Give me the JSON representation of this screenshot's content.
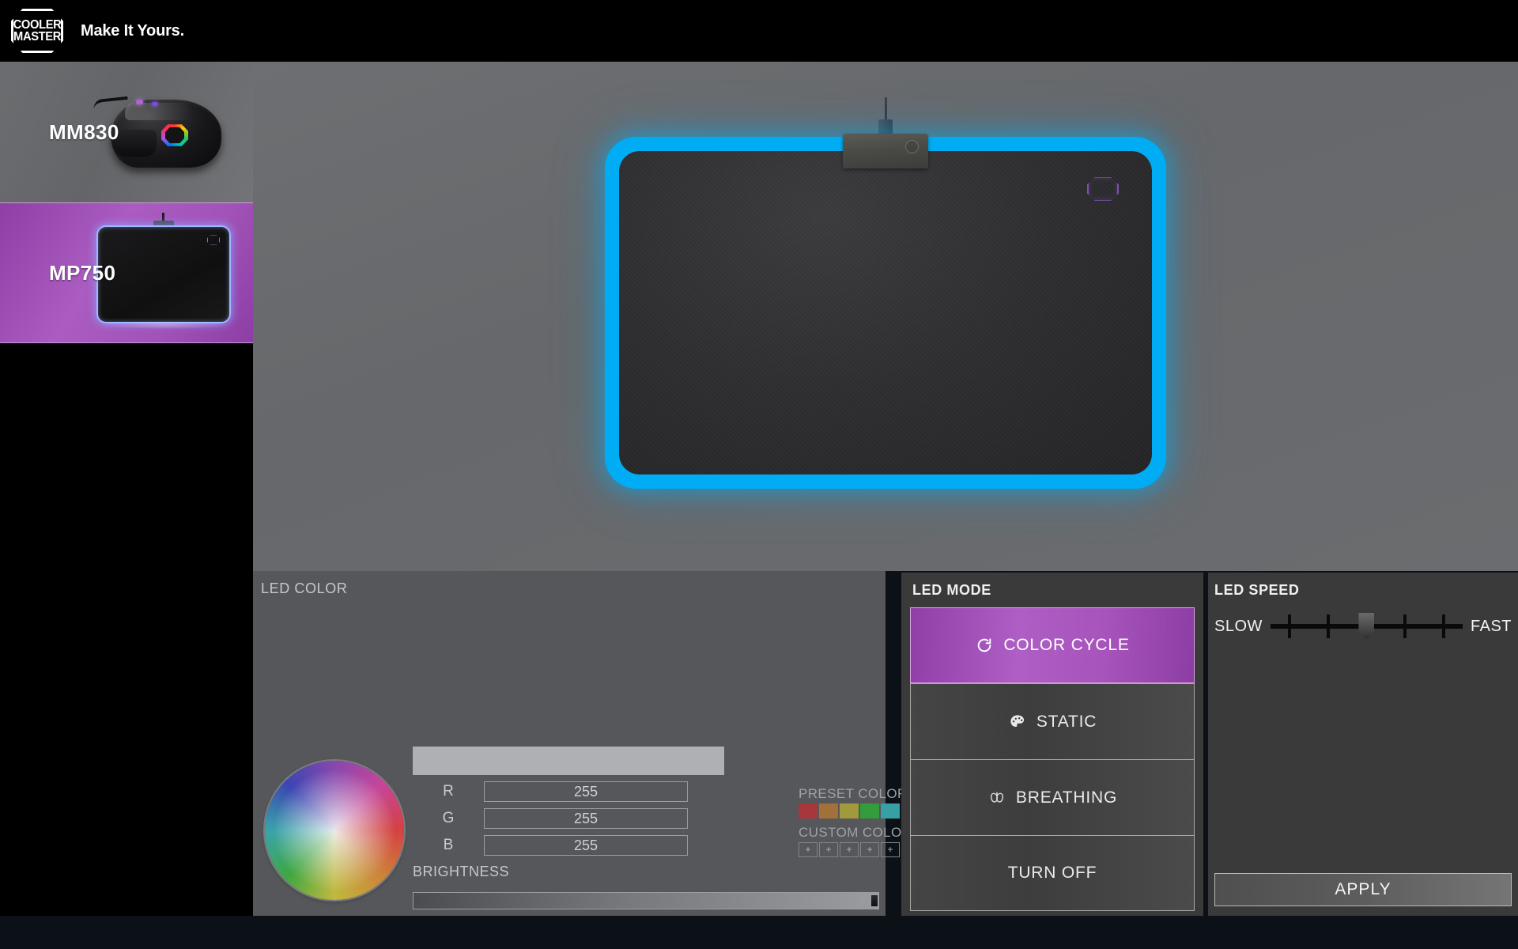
{
  "app": {
    "brand_line1": "COOLER",
    "brand_line2": "MASTER",
    "tagline": "Make It Yours.",
    "accent_purple": "#a754bc",
    "led_preview_color": "#00adf4"
  },
  "sidebar": {
    "devices": [
      {
        "name": "MM830",
        "type": "mouse",
        "selected": false
      },
      {
        "name": "MP750",
        "type": "mousepad",
        "selected": true
      }
    ]
  },
  "led_color": {
    "title": "LED COLOR",
    "preview_swatch": "#aeb0b3",
    "channels": [
      {
        "label": "R",
        "value": "255"
      },
      {
        "label": "G",
        "value": "255"
      },
      {
        "label": "B",
        "value": "255"
      }
    ],
    "brightness_label": "BRIGHTNESS",
    "brightness_value": 100,
    "preset_colors_label": "PRESET COLORS",
    "preset_colors": [
      "#a8373c",
      "#a2713a",
      "#a09a3c",
      "#339c3c",
      "#37a0a4",
      "#3639a8",
      "#6b4e80"
    ],
    "custom_colors_label": "CUSTOM COLORS",
    "custom_slots": [
      "+",
      "+",
      "+",
      "+",
      "+",
      "+",
      "+"
    ]
  },
  "led_mode": {
    "title": "LED MODE",
    "modes": [
      {
        "label": "COLOR CYCLE",
        "icon": "refresh-cycle-icon",
        "selected": true
      },
      {
        "label": "STATIC",
        "icon": "palette-icon",
        "selected": false
      },
      {
        "label": "BREATHING",
        "icon": "lungs-icon",
        "selected": false
      },
      {
        "label": "TURN OFF",
        "icon": "none",
        "selected": false
      }
    ]
  },
  "led_speed": {
    "title": "LED SPEED",
    "slow_label": "SLOW",
    "fast_label": "FAST",
    "ticks": 5,
    "value": 3,
    "apply_label": "APPLY"
  }
}
